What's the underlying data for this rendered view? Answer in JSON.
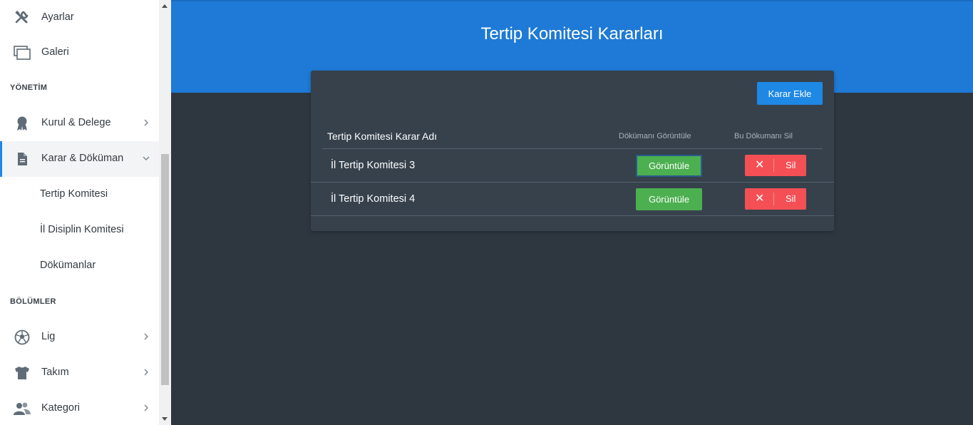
{
  "sidebar": {
    "items_top": [
      {
        "label": "Ayarlar",
        "icon": "tools-icon"
      },
      {
        "label": "Galeri",
        "icon": "gallery-icon"
      }
    ],
    "section_yonetim": "YÖNETİM",
    "yonetim_items": [
      {
        "label": "Kurul & Delege",
        "icon": "medal-icon"
      },
      {
        "label": "Karar & Döküman",
        "icon": "document-icon"
      }
    ],
    "sub_items": [
      {
        "label": "Tertip Komitesi"
      },
      {
        "label": "İl Disiplin Komitesi"
      },
      {
        "label": "Dökümanlar"
      }
    ],
    "section_bolumler": "BÖLÜMLER",
    "bolumler_items": [
      {
        "label": "Lig",
        "icon": "soccer-ball-icon"
      },
      {
        "label": "Takım",
        "icon": "shirt-icon"
      },
      {
        "label": "Kategori",
        "icon": "users-icon"
      }
    ]
  },
  "main": {
    "title": "Tertip Komitesi Kararları",
    "add_button": "Karar Ekle",
    "table": {
      "col_name": "Tertip Komitesi Karar Adı",
      "col_view": "Dökümanı Görüntüle",
      "col_delete": "Bu Dökumanı Sil",
      "rows": [
        {
          "name": "İl Tertip Komitesi 3",
          "view_label": "Görüntüle",
          "delete_label": "Sil"
        },
        {
          "name": "İl Tertip Komitesi 4",
          "view_label": "Görüntüle",
          "delete_label": "Sil"
        }
      ]
    }
  },
  "colors": {
    "banner": "#1e7ad6",
    "accent": "#1e88e5",
    "view_button": "#4caf50",
    "delete_button": "#f44f55",
    "background": "#2e3740",
    "card": "#36414c"
  }
}
